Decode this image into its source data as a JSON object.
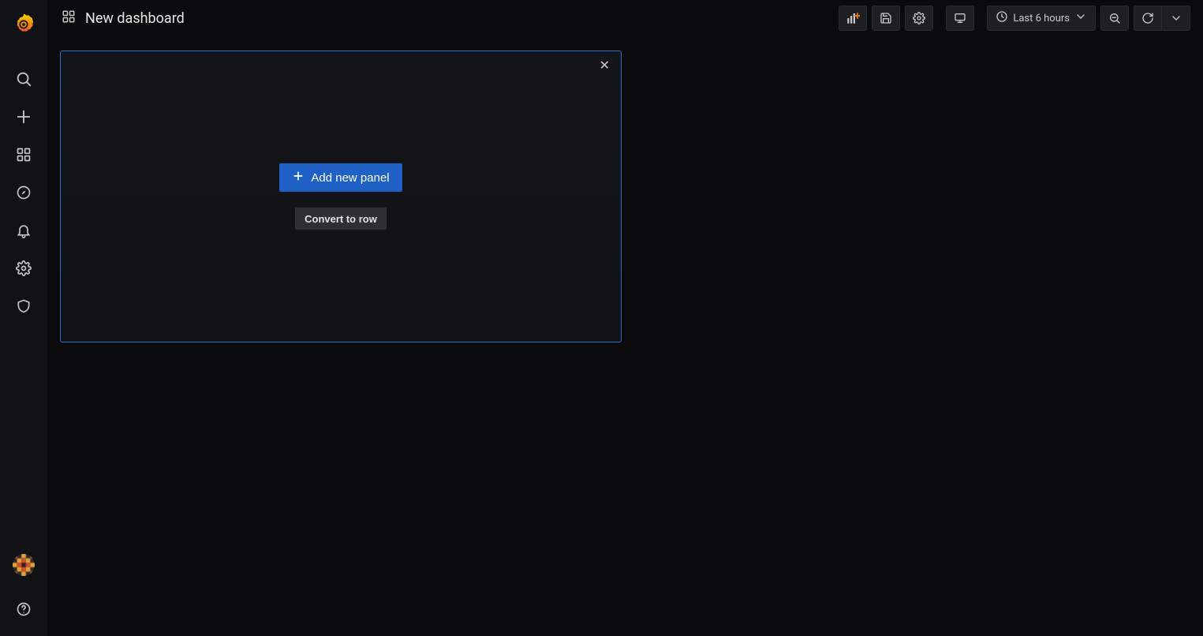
{
  "header": {
    "title": "New dashboard"
  },
  "toolbar": {
    "time_range_label": "Last 6 hours"
  },
  "panel": {
    "add_panel_label": "Add new panel",
    "convert_row_label": "Convert to row"
  },
  "icons": {
    "grafana": "grafana-logo-icon",
    "dashboards_crumb": "apps-icon",
    "search": "search-icon",
    "create": "plus-icon",
    "dashboards": "apps-icon",
    "explore": "compass-icon",
    "alerting": "bell-icon",
    "config": "gear-icon",
    "admin": "shield-icon",
    "help": "question-circle-icon",
    "add_panel": "panel-add-icon",
    "save": "save-icon",
    "settings": "gear-icon",
    "view": "monitor-icon",
    "clock": "clock-icon",
    "chevron_down": "chevron-down-icon",
    "zoom_out": "search-minus-icon",
    "refresh": "sync-icon",
    "close": "close-icon",
    "plus_small": "plus-icon"
  }
}
